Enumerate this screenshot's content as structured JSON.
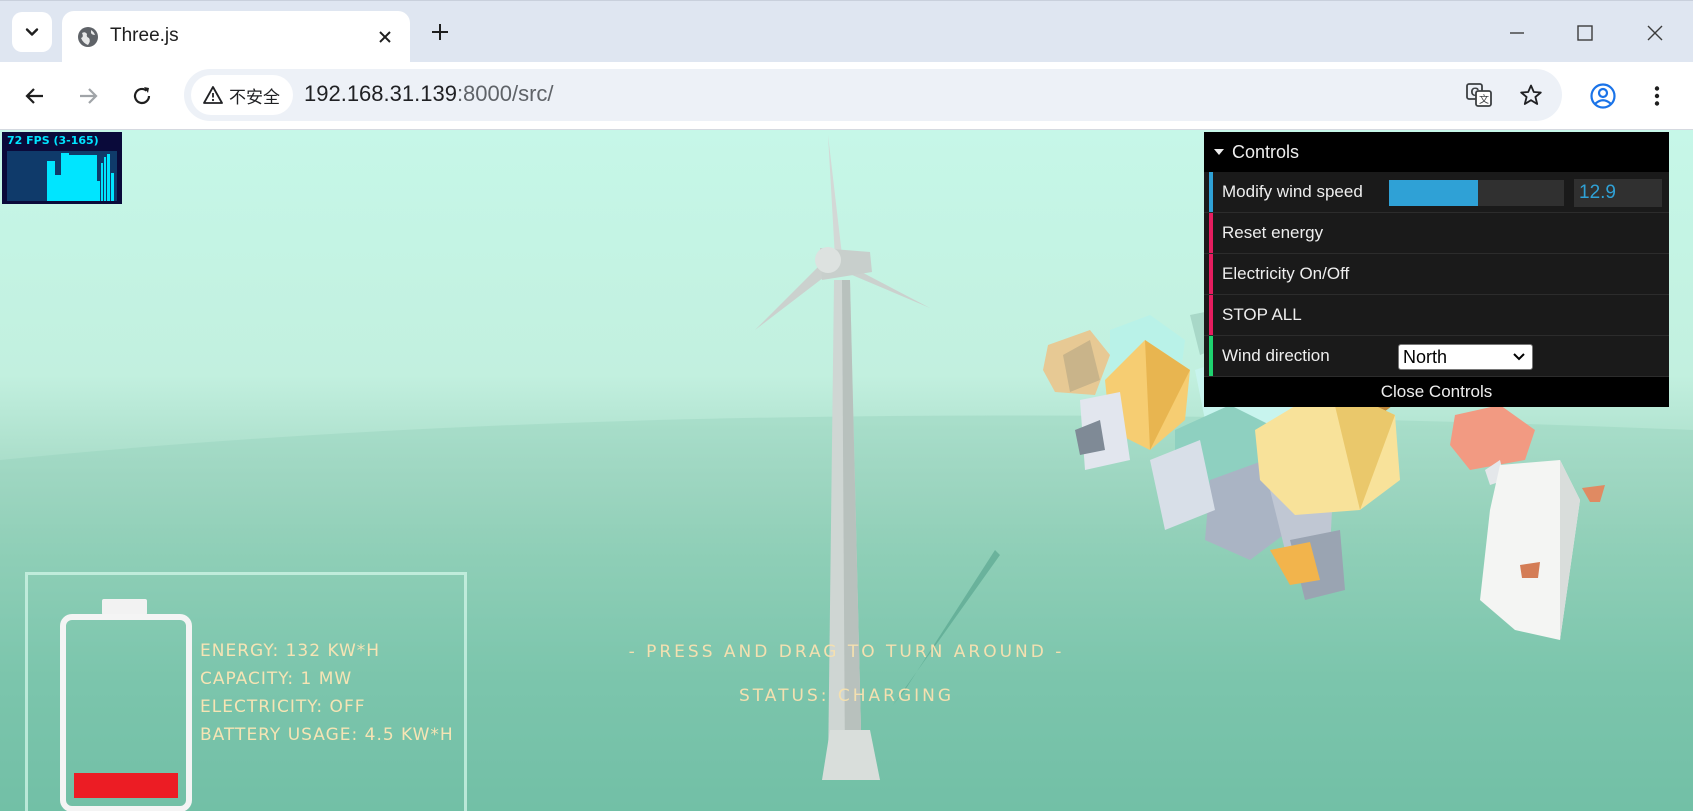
{
  "browser": {
    "tab_title": "Three.js",
    "security_label": "不安全",
    "url_host": "192.168.31.139",
    "url_rest": ":8000/src/"
  },
  "stats_panel": {
    "fps_text": "72 FPS (3-165)"
  },
  "controls": {
    "title": "Controls",
    "wind_speed_label": "Modify wind speed",
    "wind_speed_value": "12.9",
    "wind_speed_fraction": 0.51,
    "reset_energy_label": "Reset energy",
    "electricity_label": "Electricity On/Off",
    "stop_all_label": "STOP ALL",
    "wind_direction_label": "Wind direction",
    "wind_direction_value": "North",
    "close_label": "Close Controls",
    "colors": {
      "number_accent": "#2fa1d6",
      "button_accent": "#e61d5f",
      "select_accent": "#806787"
    }
  },
  "hud": {
    "energy": "ENERGY: 132 KW*H",
    "capacity": "CAPACITY: 1 MW",
    "electricity": "ELECTRICITY: OFF",
    "battery_usage": "BATTERY USAGE: 4.5 KW*H",
    "battery_level_fraction": 0.14,
    "battery_color": "#ec1c24"
  },
  "hints": {
    "drag": "- PRESS AND DRAG TO TURN AROUND -",
    "status": "STATUS: CHARGING"
  }
}
